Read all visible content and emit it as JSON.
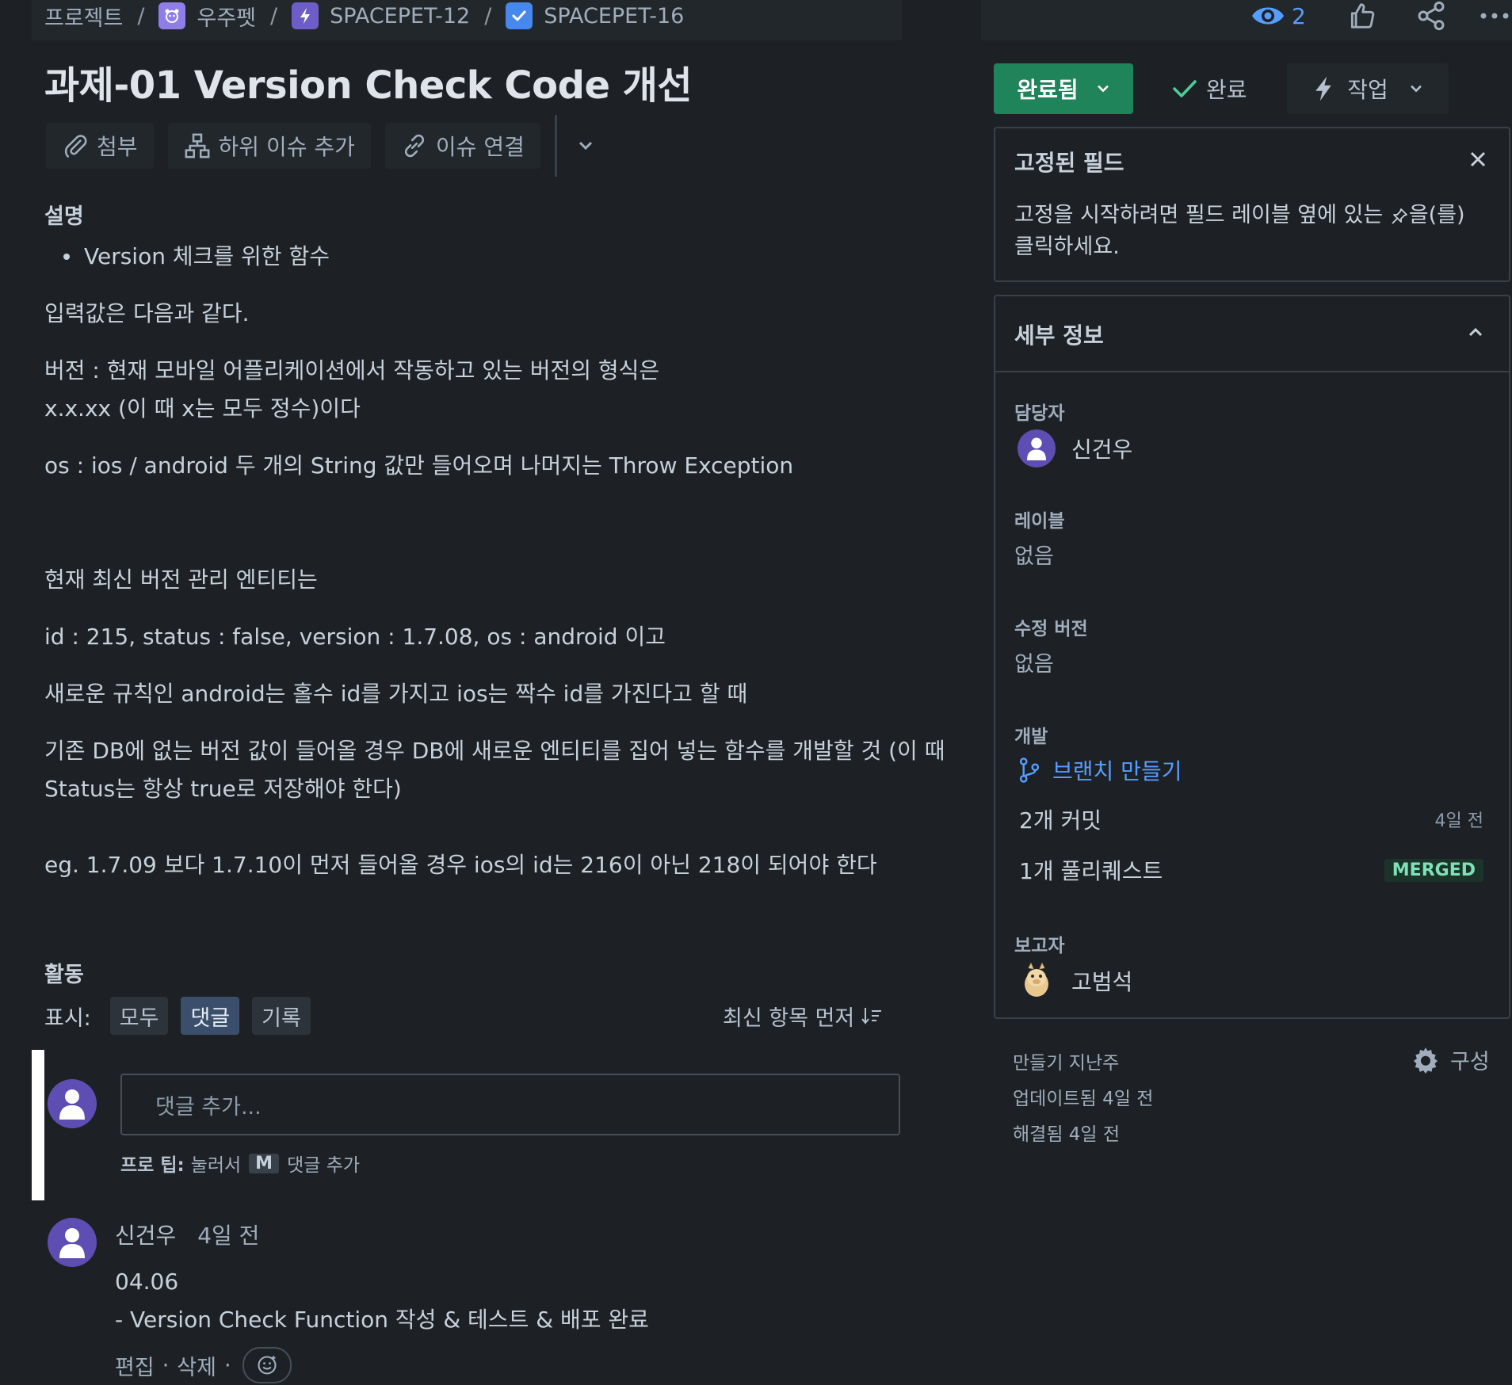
{
  "breadcrumb": {
    "items": [
      {
        "label": "프로젝트"
      },
      {
        "label": "우주펫",
        "icon": "project-icon",
        "color": "#8f7ee7"
      },
      {
        "label": "SPACEPET-12",
        "icon": "epic-icon",
        "color": "#6e5dc6"
      },
      {
        "label": "SPACEPET-16",
        "icon": "task-icon",
        "color": "#4688ec"
      }
    ],
    "separator": "/"
  },
  "topbar": {
    "watch_count": "2",
    "icons": [
      "eye-icon",
      "thumbs-up-icon",
      "share-icon",
      "more-icon"
    ]
  },
  "issue": {
    "title": "과제-01 Version Check Code 개선"
  },
  "actions": {
    "attach": "첨부",
    "add_child": "하위 이슈 추가",
    "link_issue": "이슈 연결"
  },
  "description": {
    "heading": "설명",
    "bullet": "Version 체크를 위한 함수",
    "p1": "입력값은 다음과 같다.",
    "p2a": "버전 : 현재 모바일 어플리케이션에서 작동하고 있는 버전의 형식은",
    "p2b": "x.x.xx (이 때 x는 모두 정수)이다",
    "p3": "os : ios / android 두 개의 String 값만 들어오며 나머지는 Throw Exception",
    "p4": "현재 최신 버전 관리 엔티티는",
    "p5": "id : 215, status : false, version : 1.7.08, os : android 이고",
    "p6": "새로운 규칙인 android는 홀수 id를 가지고 ios는 짝수 id를 가진다고 할 때",
    "p7a": "기존 DB에 없는 버전 값이 들어올 경우 DB에 새로운 엔티티를 집어 넣는 함수를 개발할 것 (이 때",
    "p7b": "Status는 항상 true로 저장해야 한다)",
    "p8": "eg. 1.7.09 보다 1.7.10이 먼저 들어올 경우 ios의 id는 216이 아닌 218이 되어야 한다"
  },
  "activity": {
    "heading": "활동",
    "show_label": "표시:",
    "filters": [
      {
        "label": "모두",
        "active": false
      },
      {
        "label": "댓글",
        "active": true
      },
      {
        "label": "기록",
        "active": false
      }
    ],
    "sort_label": "최신 항목 먼저",
    "comment_placeholder": "댓글 추가...",
    "protip_label": "프로 팁:",
    "protip_pre": "눌러서",
    "protip_key": "M",
    "protip_post": "댓글 추가"
  },
  "comment": {
    "author": "신건우",
    "time": "4일 전",
    "line1": "04.06",
    "line2": "- Version Check Function 작성 & 테스트 & 배포 완료",
    "edit": "편집",
    "delete": "삭제",
    "dot": "·"
  },
  "status": {
    "label": "완료됨",
    "color": "#1f845a",
    "done_label": "완료",
    "work_label": "작업"
  },
  "pinned": {
    "title": "고정된 필드",
    "body_pre": "고정을 시작하려면 필드 레이블 옆에 있는",
    "body_post": "을(를) 클릭하세요."
  },
  "details": {
    "title": "세부 정보",
    "assignee_label": "담당자",
    "assignee": "신건우",
    "labels_label": "레이블",
    "labels_value": "없음",
    "fix_version_label": "수정 버전",
    "fix_version_value": "없음",
    "dev_label": "개발",
    "create_branch": "브랜치 만들기",
    "commits": "2개 커밋",
    "commits_time": "4일 전",
    "pull_requests": "1개 풀리퀘스트",
    "pr_status": "MERGED",
    "reporter_label": "보고자",
    "reporter": "고범석"
  },
  "meta": {
    "created": "만들기 지난주",
    "updated": "업데이트됨 4일 전",
    "resolved": "해결됨 4일 전",
    "configure": "구성"
  }
}
